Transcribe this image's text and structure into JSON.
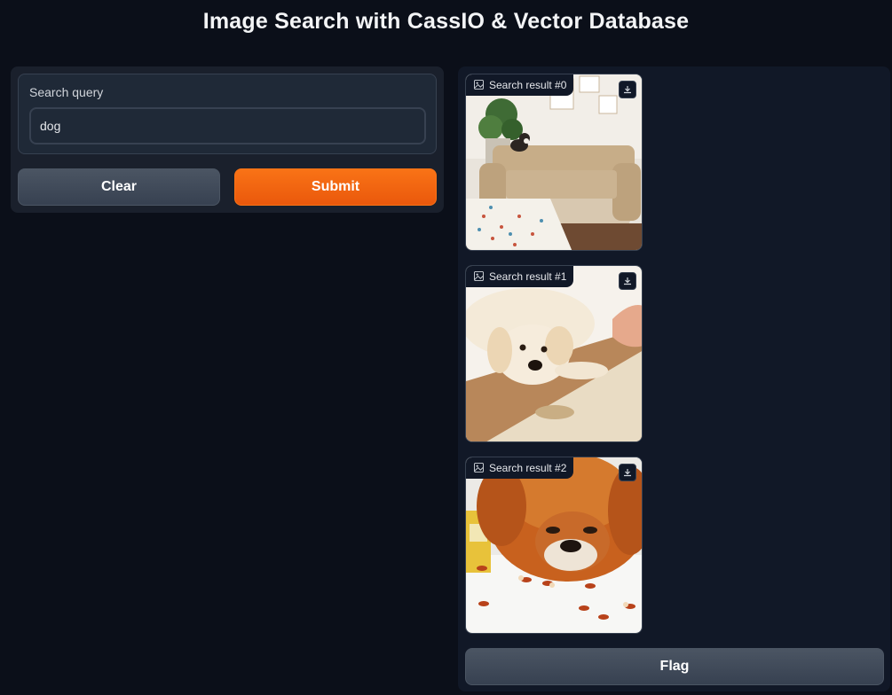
{
  "title": "Image Search with CassIO & Vector Database",
  "search": {
    "label": "Search query",
    "value": "dog"
  },
  "buttons": {
    "clear": "Clear",
    "submit": "Submit",
    "flag": "Flag"
  },
  "results": [
    {
      "label": "Search result #0"
    },
    {
      "label": "Search result #1"
    },
    {
      "label": "Search result #2"
    }
  ],
  "colors": {
    "background": "#0b0f19",
    "accent": "#f97316",
    "panel": "#1a202c"
  },
  "icons": {
    "result_badge": "image-icon",
    "result_action": "download-icon"
  }
}
